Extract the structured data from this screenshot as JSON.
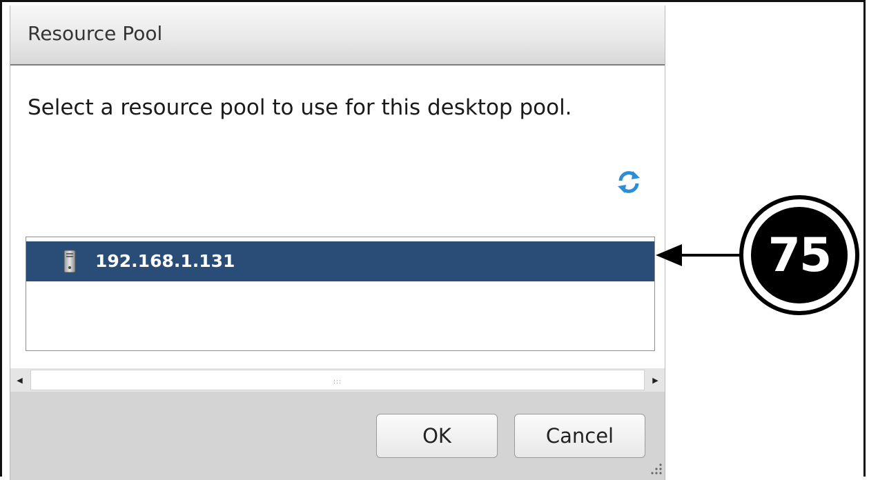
{
  "dialog": {
    "title": "Resource Pool",
    "instruction": "Select a resource pool to use for this desktop pool.",
    "refresh_icon": "refresh-icon",
    "list": {
      "items": [
        {
          "label": "192.168.1.131",
          "icon": "server-icon",
          "selected": true
        }
      ]
    },
    "scrollbar": {
      "left_icon": "scroll-left-arrow-icon",
      "right_icon": "scroll-right-arrow-icon",
      "grip": ":::"
    },
    "buttons": {
      "ok": "OK",
      "cancel": "Cancel"
    }
  },
  "callout": {
    "number": "75"
  },
  "colors": {
    "selection": "#2a4d78",
    "title_bar": "#e9e9e9",
    "footer": "#d4d4d4",
    "refresh": "#2a8fd8"
  }
}
